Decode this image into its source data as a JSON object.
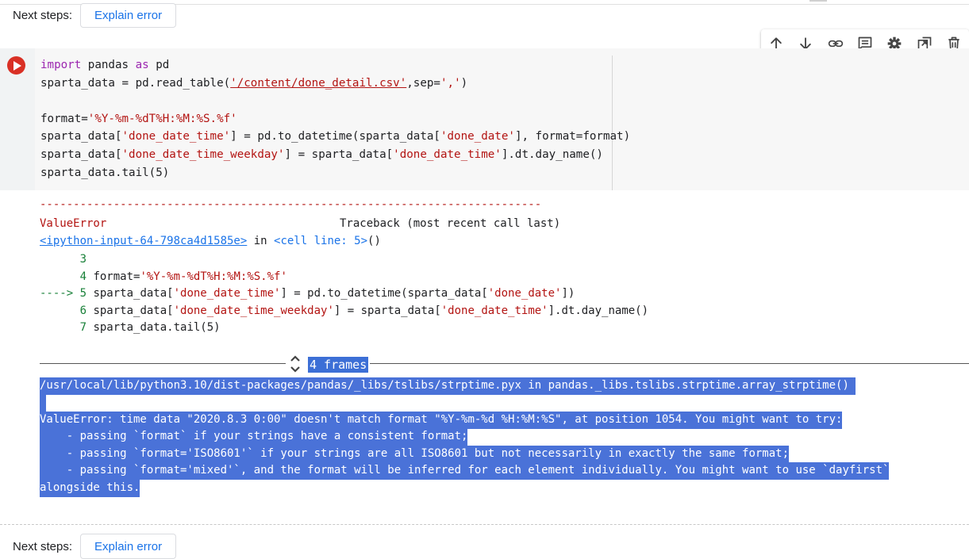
{
  "next_steps": {
    "label": "Next steps:",
    "button": "Explain error"
  },
  "toolbar": {
    "icons": [
      "arrow-up-icon",
      "arrow-down-icon",
      "link-icon",
      "comment-icon",
      "gear-icon",
      "mirror-cell-icon",
      "trash-icon"
    ]
  },
  "code_cell": {
    "lines": [
      [
        "import",
        " pandas ",
        "as",
        " pd"
      ],
      [
        "sparta_data = pd.read_table(",
        "'/content/done_detail.csv'",
        ",sep=",
        "','",
        ")"
      ],
      [
        ""
      ],
      [
        "format=",
        "'%Y-%m-%dT%H:%M:%S.%f'"
      ],
      [
        "sparta_data[",
        "'done_date_time'",
        "] = pd.to_datetime(sparta_data[",
        "'done_date'",
        "], format=format)"
      ],
      [
        "sparta_data[",
        "'done_date_time_weekday'",
        "] = sparta_data[",
        "'done_date_time'",
        "].dt.day_name()"
      ],
      [
        "sparta_data.tail(5)"
      ]
    ]
  },
  "traceback": {
    "dashes": "---------------------------------------------------------------------------",
    "error_name": "ValueError",
    "header_right": "Traceback (most recent call last)",
    "input_link": "<ipython-input-64-798ca4d1585e>",
    "in_text": " in ",
    "cell_line": "<cell line: 5>",
    "cell_line_suffix": "()",
    "lines": [
      {
        "prefix": "      3",
        "a": "",
        "s1": "",
        "b": "",
        "s2": "",
        "c": ""
      },
      {
        "prefix": "      4 ",
        "a": "format=",
        "s1": "'%Y-%m-%dT%H:%M:%S.%f'",
        "b": "",
        "s2": "",
        "c": ""
      },
      {
        "prefix": "----> 5 ",
        "a": "sparta_data[",
        "s1": "'done_date_time'",
        "b": "] = pd.to_datetime(sparta_data[",
        "s2": "'done_date'",
        "c": "])"
      },
      {
        "prefix": "      6 ",
        "a": "sparta_data[",
        "s1": "'done_date_time_weekday'",
        "b": "] = sparta_data[",
        "s2": "'done_date_time'",
        "c": "].dt.day_name()"
      },
      {
        "prefix": "      7 ",
        "a": "sparta_data.tail(5)",
        "s1": "",
        "b": "",
        "s2": "",
        "c": ""
      }
    ],
    "frames_label": "4 frames",
    "selected_lines": [
      "/usr/local/lib/python3.10/dist-packages/pandas/_libs/tslibs/strptime.pyx in pandas._libs.tslibs.strptime.array_strptime() ",
      " ",
      "ValueError: time data \"2020.8.3 0:00\" doesn't match format \"%Y-%m-%d %H:%M:%S\", at position 1054. You might want to try:",
      "    - passing `format` if your strings have a consistent format;",
      "    - passing `format='ISO8601'` if your strings are all ISO8601 but not necessarily in exactly the same format;",
      "    - passing `format='mixed'`, and the format will be inferred for each element individually. You might want to use `dayfirst`",
      "alongside this."
    ]
  }
}
